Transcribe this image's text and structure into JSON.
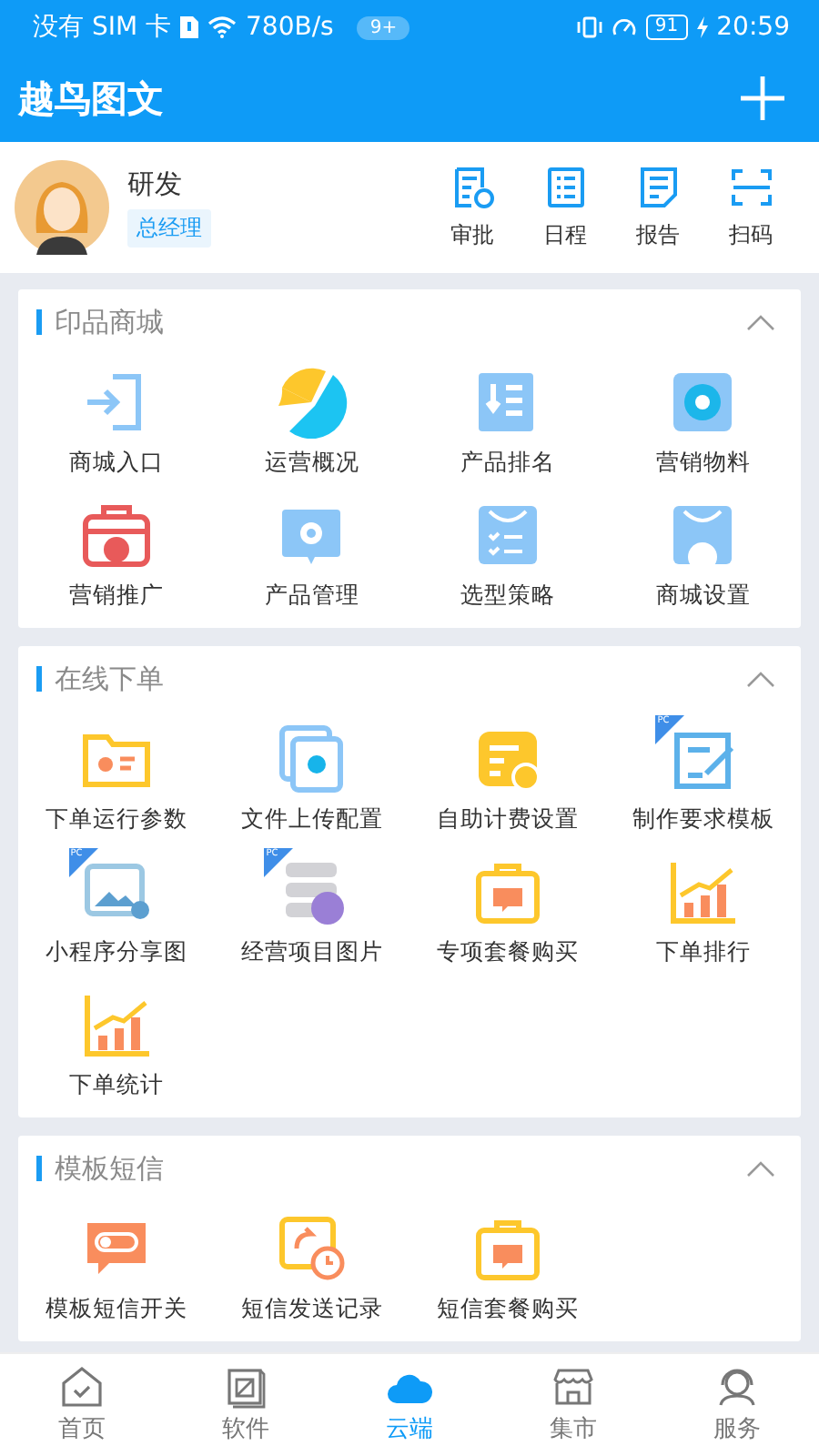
{
  "status_bar": {
    "carrier": "没有 SIM 卡",
    "speed": "780B/s",
    "notifications": "9+",
    "battery": "91",
    "time": "20:59"
  },
  "header": {
    "title": "越鸟图文"
  },
  "profile": {
    "name": "研发",
    "role": "总经理",
    "actions": [
      {
        "label": "审批"
      },
      {
        "label": "日程"
      },
      {
        "label": "报告"
      },
      {
        "label": "扫码"
      }
    ]
  },
  "sections": [
    {
      "title": "印品商城",
      "expanded": true,
      "items": [
        {
          "label": "商城入口"
        },
        {
          "label": "运营概况"
        },
        {
          "label": "产品排名"
        },
        {
          "label": "营销物料"
        },
        {
          "label": "营销推广"
        },
        {
          "label": "产品管理"
        },
        {
          "label": "选型策略"
        },
        {
          "label": "商城设置"
        }
      ]
    },
    {
      "title": "在线下单",
      "expanded": true,
      "items": [
        {
          "label": "下单运行参数"
        },
        {
          "label": "文件上传配置"
        },
        {
          "label": "自助计费设置"
        },
        {
          "label": "制作要求模板",
          "badge": "PC"
        },
        {
          "label": "小程序分享图",
          "badge": "PC"
        },
        {
          "label": "经营项目图片",
          "badge": "PC"
        },
        {
          "label": "专项套餐购买"
        },
        {
          "label": "下单排行"
        },
        {
          "label": "下单统计"
        }
      ]
    },
    {
      "title": "模板短信",
      "expanded": true,
      "items": [
        {
          "label": "模板短信开关"
        },
        {
          "label": "短信发送记录"
        },
        {
          "label": "短信套餐购买"
        }
      ]
    }
  ],
  "tab_bar": [
    {
      "label": "首页",
      "selected": false
    },
    {
      "label": "软件",
      "selected": false
    },
    {
      "label": "云端",
      "selected": true
    },
    {
      "label": "集市",
      "selected": false
    },
    {
      "label": "服务",
      "selected": false
    }
  ]
}
